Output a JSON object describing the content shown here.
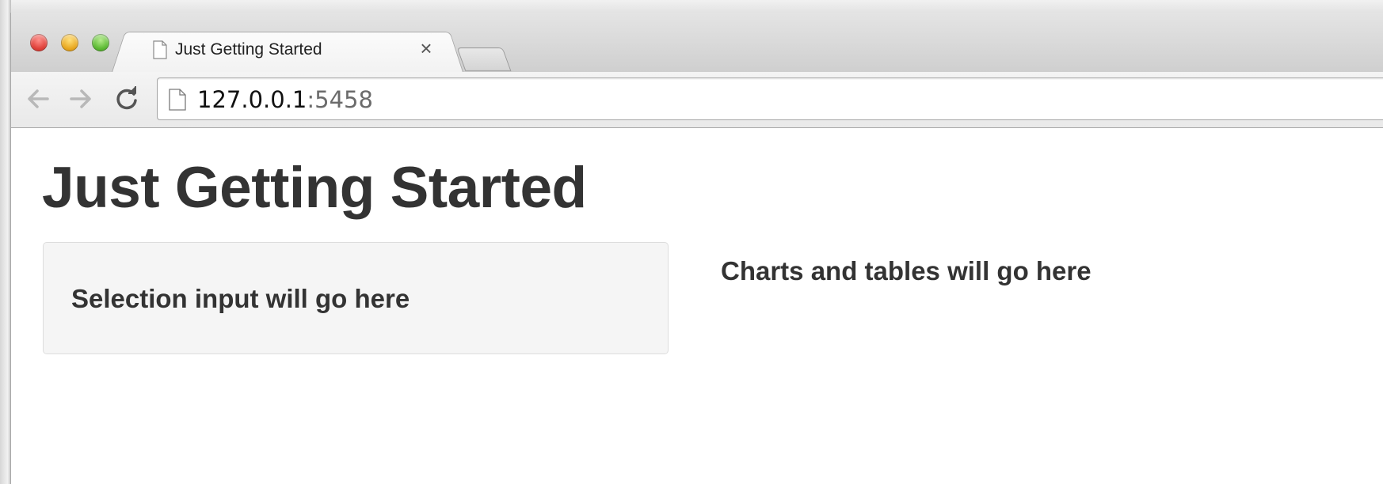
{
  "browser": {
    "tab": {
      "title": "Just Getting Started",
      "close_glyph": "×"
    },
    "address_bar": {
      "host": "127.0.0.1",
      "port": ":5458"
    },
    "icons": {
      "back": "arrow-left-icon",
      "forward": "arrow-right-icon",
      "reload": "reload-icon",
      "page": "page-icon"
    }
  },
  "page": {
    "title": "Just Getting Started",
    "sidebar": {
      "text": "Selection input will go here"
    },
    "main": {
      "text": "Charts and tables will go here"
    }
  },
  "colors": {
    "text": "#333333",
    "well_background": "#f5f5f5",
    "well_border": "#dddddd"
  }
}
